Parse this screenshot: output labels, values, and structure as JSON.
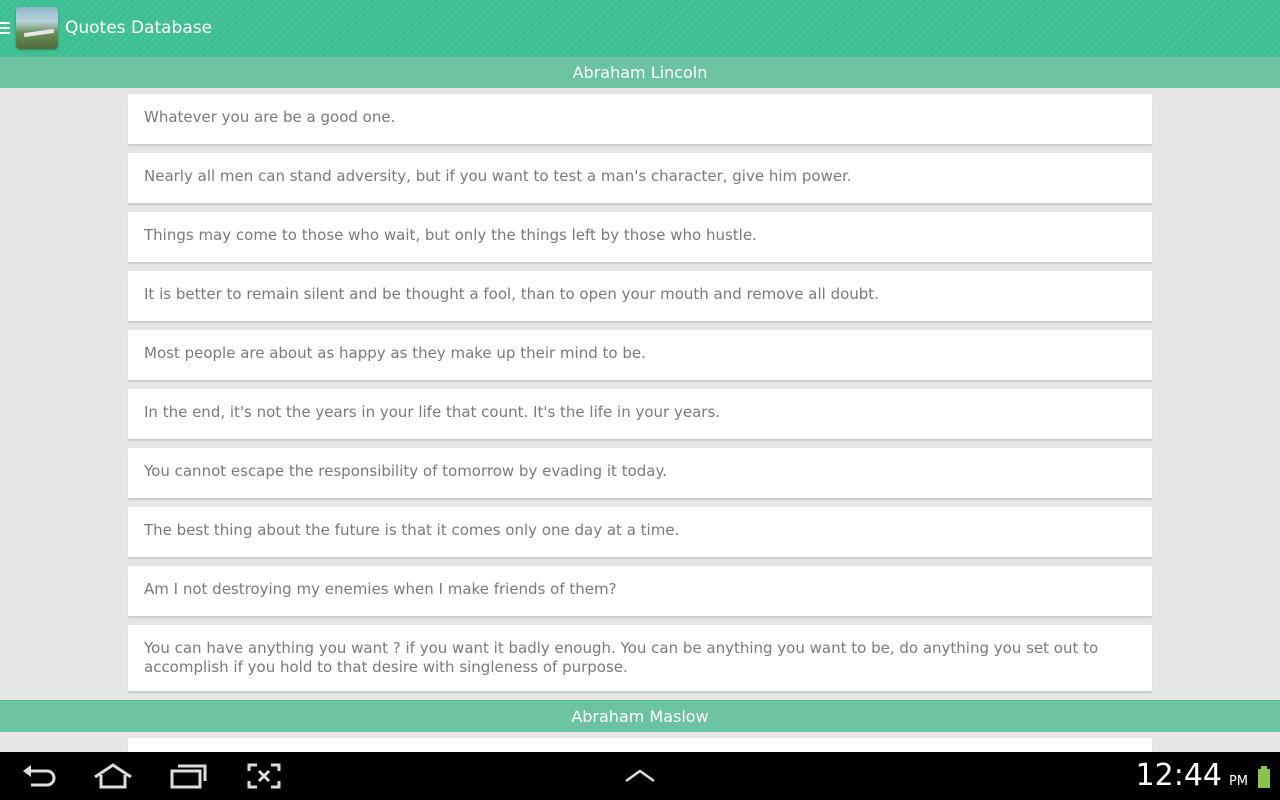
{
  "app": {
    "title": "Quotes Database"
  },
  "sections": [
    {
      "author": "Abraham Lincoln",
      "quotes": [
        "Whatever you are be a good one.",
        "Nearly all men can stand adversity, but if you want to test a man's character, give him power.",
        "Things may come to those who wait, but only the things left by those who hustle.",
        "It is better to remain silent and be thought a fool, than to open your mouth and remove all doubt.",
        "Most people are about as happy as they make up their mind to be.",
        "In the end, it's not the years in your life that count. It's the life in your years.",
        "You cannot escape the responsibility of tomorrow by evading it today.",
        "The best thing about the future is that it comes only one day at a time.",
        "Am I not destroying my enemies when I make friends of them?",
        "You can have anything you want ? if you want it badly enough. You can be anything you want to be, do anything you set out to accomplish if you hold to that desire with singleness of purpose."
      ]
    },
    {
      "author": "Abraham Maslow",
      "quotes": [
        ""
      ]
    }
  ],
  "status_bar": {
    "time": "12:44",
    "ampm": "PM"
  },
  "icons": {
    "menu": "menu-icon",
    "back": "back-icon",
    "home": "home-icon",
    "recents": "recent-apps-icon",
    "screenshot": "screenshot-icon",
    "up": "chevron-up-icon",
    "battery": "battery-icon"
  },
  "colors": {
    "app_bar": "#3dbf91",
    "section_header": "#6cc3a2",
    "background": "#e6e6e6",
    "quote_text": "#7a7a7a",
    "battery": "#8bc34a"
  }
}
